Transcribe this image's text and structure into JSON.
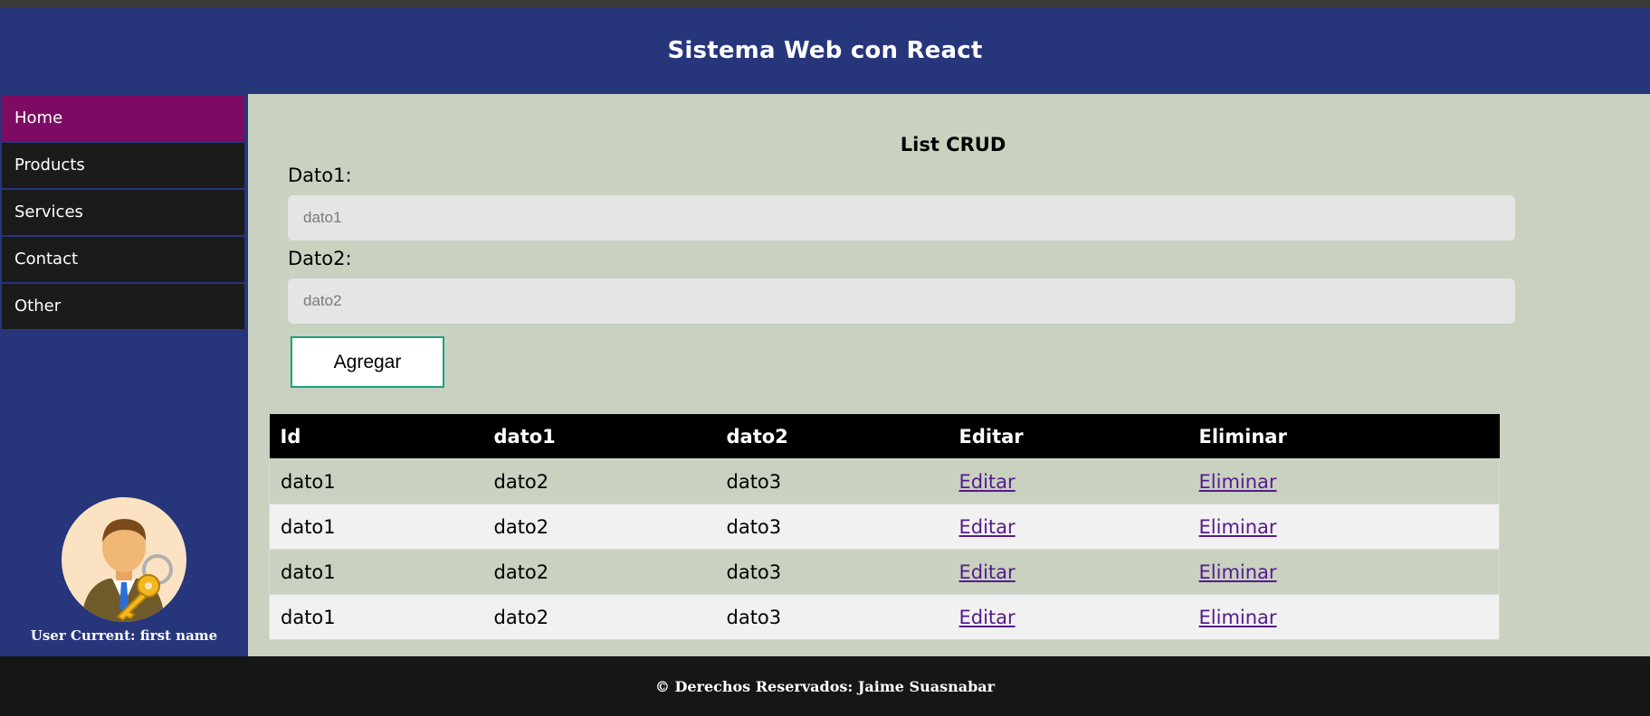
{
  "header": {
    "title": "Sistema Web con React"
  },
  "sidebar": {
    "items": [
      {
        "label": "Home",
        "active": true
      },
      {
        "label": "Products"
      },
      {
        "label": "Services"
      },
      {
        "label": "Contact"
      },
      {
        "label": "Other"
      }
    ],
    "user": {
      "label": "User Current: first name",
      "icon": "user-key-icon"
    }
  },
  "main": {
    "title": "List CRUD",
    "form": {
      "field1": {
        "label": "Dato1:",
        "placeholder": "dato1",
        "value": ""
      },
      "field2": {
        "label": "Dato2:",
        "placeholder": "dato2",
        "value": ""
      },
      "submit_label": "Agregar"
    },
    "table": {
      "headers": [
        "Id",
        "dato1",
        "dato2",
        "Editar",
        "Eliminar"
      ],
      "rows": [
        [
          "dato1",
          "dato2",
          "dato3",
          "Editar",
          "Eliminar"
        ],
        [
          "dato1",
          "dato2",
          "dato3",
          "Editar",
          "Eliminar"
        ],
        [
          "dato1",
          "dato2",
          "dato3",
          "Editar",
          "Eliminar"
        ],
        [
          "dato1",
          "dato2",
          "dato3",
          "Editar",
          "Eliminar"
        ]
      ]
    }
  },
  "footer": {
    "text": "© Derechos Reservados: Jaime Suasnabar"
  },
  "colors": {
    "header_bg": "#27357a",
    "active_nav": "#7d0b63",
    "nav_bg": "#1b1b1b",
    "main_bg": "#c9d1c1",
    "footer_bg": "#161616",
    "button_border": "#1aa37a"
  }
}
